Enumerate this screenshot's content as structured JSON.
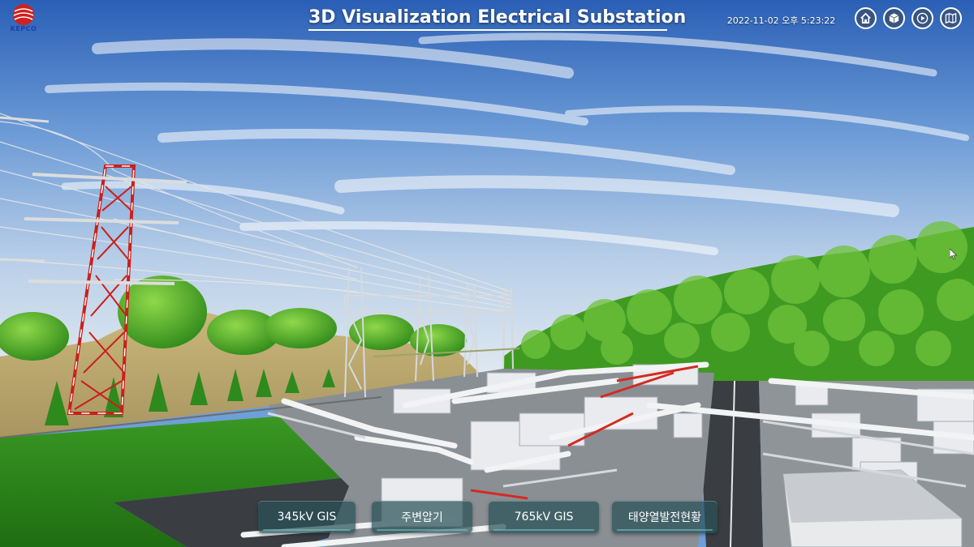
{
  "app": {
    "logo_text": "KEPCO",
    "title": "3D Visualization Electrical Substation",
    "datetime": "2022-11-02 오후 5:23:22"
  },
  "toolbar": {
    "buttons": [
      {
        "name": "home",
        "icon": "home-icon"
      },
      {
        "name": "cube",
        "icon": "cube-icon"
      },
      {
        "name": "play",
        "icon": "play-icon"
      },
      {
        "name": "map",
        "icon": "map-icon"
      }
    ]
  },
  "menu": {
    "items": [
      {
        "label": "345kV GIS"
      },
      {
        "label": "주변압기"
      },
      {
        "label": "765kV GIS"
      },
      {
        "label": "태양열발전현황"
      }
    ]
  },
  "colors": {
    "sky_top": "#2e64b8",
    "sky_bottom": "#cfe0f0",
    "grass": "#2f8a1c",
    "forest": "#3f9a22",
    "tower_red": "#c8201c",
    "menu_bg": "#285058"
  }
}
